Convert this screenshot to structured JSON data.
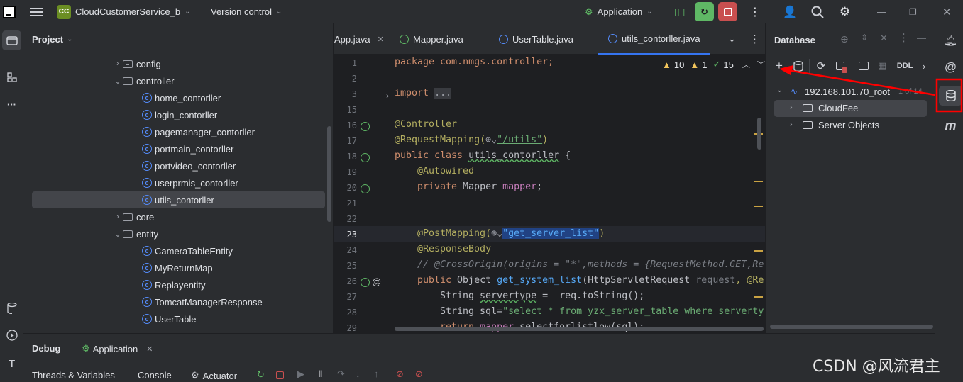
{
  "titlebar": {
    "project_badge": "CC",
    "project_name": "CloudCustomerService_b",
    "vcs": "Version control",
    "run_config": "Application"
  },
  "project_panel": {
    "title": "Project",
    "tree": [
      {
        "label": "config",
        "type": "folder",
        "expanded": false
      },
      {
        "label": "controller",
        "type": "folder",
        "expanded": true
      },
      {
        "label": "home_contorller",
        "type": "class"
      },
      {
        "label": "login_contorller",
        "type": "class"
      },
      {
        "label": "pagemanager_contorller",
        "type": "class"
      },
      {
        "label": "portmain_contorller",
        "type": "class"
      },
      {
        "label": "portvideo_contorller",
        "type": "class"
      },
      {
        "label": "userprmis_contorller",
        "type": "class"
      },
      {
        "label": "utils_contorller",
        "type": "class",
        "selected": true
      },
      {
        "label": "core",
        "type": "folder",
        "expanded": false
      },
      {
        "label": "entity",
        "type": "folder",
        "expanded": true
      },
      {
        "label": "CameraTableEntity",
        "type": "class"
      },
      {
        "label": "MyReturnMap",
        "type": "class"
      },
      {
        "label": "Replayentity",
        "type": "class"
      },
      {
        "label": "TomcatManagerResponse",
        "type": "class"
      },
      {
        "label": "UserTable",
        "type": "class"
      }
    ]
  },
  "editor": {
    "tabs": [
      "App.java",
      "Mapper.java",
      "UserTable.java",
      "utils_contorller.java"
    ],
    "active_tab": "utils_contorller.java",
    "inspections": {
      "warnings": "10",
      "weak": "1",
      "ok": "15"
    },
    "line_numbers": [
      "1",
      "2",
      "3",
      "15",
      "16",
      "17",
      "18",
      "19",
      "20",
      "21",
      "22",
      "23",
      "24",
      "25",
      "26",
      "27",
      "28",
      "29"
    ],
    "lines": {
      "l1": "package com.nmgs.controller;",
      "l3a": "import",
      "l3b": "...",
      "l16": "@Controller",
      "l17a": "@RequestMapping(",
      "l17b": "\"/utils\"",
      "l17c": ")",
      "l18a": "public class ",
      "l18b": "utils_contorller",
      "l18c": " {",
      "l19": "@Autowired",
      "l20a": "private ",
      "l20b": "Mapper ",
      "l20c": "mapper",
      "l20d": ";",
      "l23a": "@PostMapping(",
      "l23b": "\"get_server_list\"",
      "l23c": ")",
      "l24": "@ResponseBody",
      "l25": "// @CrossOrigin(origins = \"*\",methods = {RequestMethod.GET,Re",
      "l26a": "public ",
      "l26b": "Object ",
      "l26c": "get_system_list",
      "l26d": "(HttpServletRequest ",
      "l26e": "request",
      "l26f": ", @Re",
      "l27a": "String ",
      "l27b": "servertype",
      "l27c": " =  req.toString();",
      "l28a": "String ",
      "l28b": "sql",
      "l28c": "=",
      "l28d": "\"select * from yzx_server_table where serverty",
      "l29a": "return ",
      "l29b": "mapper",
      "l29c": ".selectforlistlow(sql);"
    }
  },
  "database_panel": {
    "title": "Database",
    "ddl": "DDL",
    "connection": "192.168.101.70_root",
    "connection_badge": "1 of 14",
    "children": [
      "CloudFee",
      "Server Objects"
    ]
  },
  "debug": {
    "title": "Debug",
    "session": "Application",
    "tabs": [
      "Threads & Variables",
      "Console",
      "Actuator"
    ]
  },
  "watermark": "CSDN @风流君主",
  "colors": {
    "accent": "#3574f0",
    "highlight": "#ff0000",
    "stop": "#c94f4f",
    "run": "#5fb865"
  }
}
